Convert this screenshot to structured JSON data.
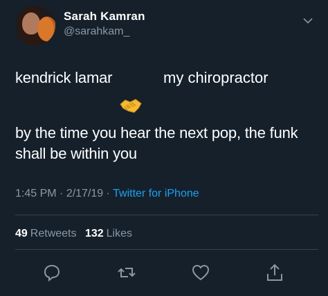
{
  "user": {
    "display_name": "Sarah Kamran",
    "handle": "@sarahkam_"
  },
  "tweet": {
    "line1_left": "kendrick lamar",
    "line1_right": "my chiropractor",
    "emoji": "handshake",
    "line2": "by the time you hear the next pop, the funk shall be within you"
  },
  "meta": {
    "time": "1:45 PM",
    "sep1": " · ",
    "date": "2/17/19",
    "sep2": " · ",
    "source": "Twitter for iPhone"
  },
  "stats": {
    "retweets_count": "49",
    "retweets_label": "Retweets",
    "likes_count": "132",
    "likes_label": "Likes"
  },
  "icons": {
    "more": "chevron-down-icon",
    "reply": "reply-icon",
    "retweet": "retweet-icon",
    "like": "heart-icon",
    "share": "share-icon"
  },
  "colors": {
    "background": "#15202b",
    "text": "#ffffff",
    "secondary": "#8899a6",
    "accent": "#1da1f2",
    "divider": "#38444d"
  }
}
